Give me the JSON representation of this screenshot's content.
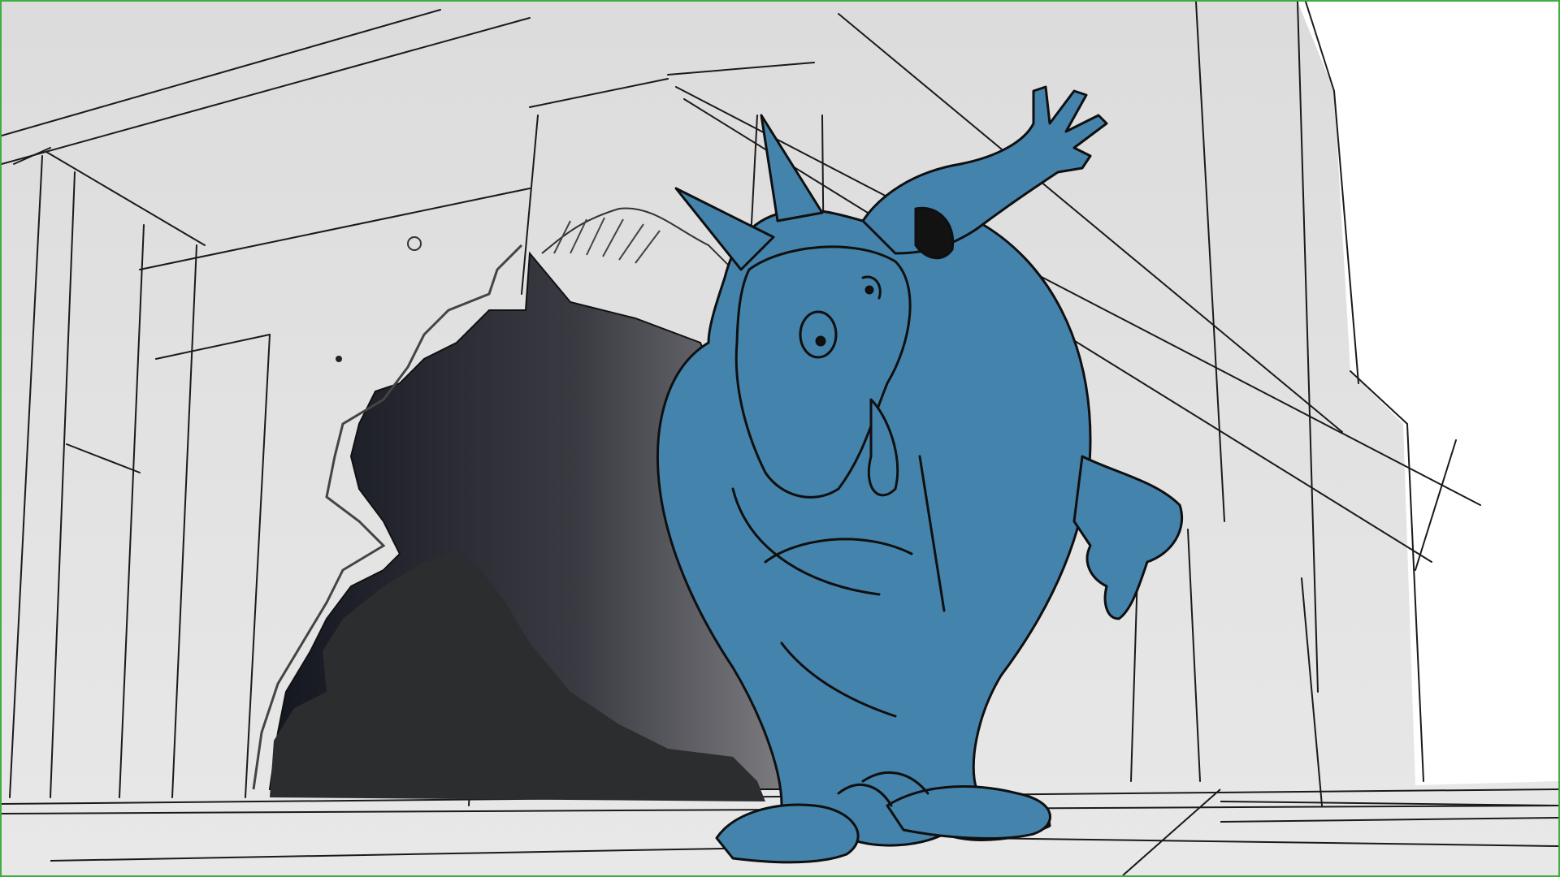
{
  "image": {
    "kind": "storyboard-panel",
    "colors": {
      "frame_border": "#3fae3f",
      "background_gray": "#e3e3e3",
      "light_sky": "#ffffff",
      "wall_shadow": "#2a2c30",
      "hole_dark": "#141620",
      "character_blue": "#4483ab",
      "sketch_line": "#141414"
    },
    "subjects": [
      "blue-creature-character",
      "broken-wall-hole",
      "building-columns",
      "dust-cloud"
    ]
  }
}
